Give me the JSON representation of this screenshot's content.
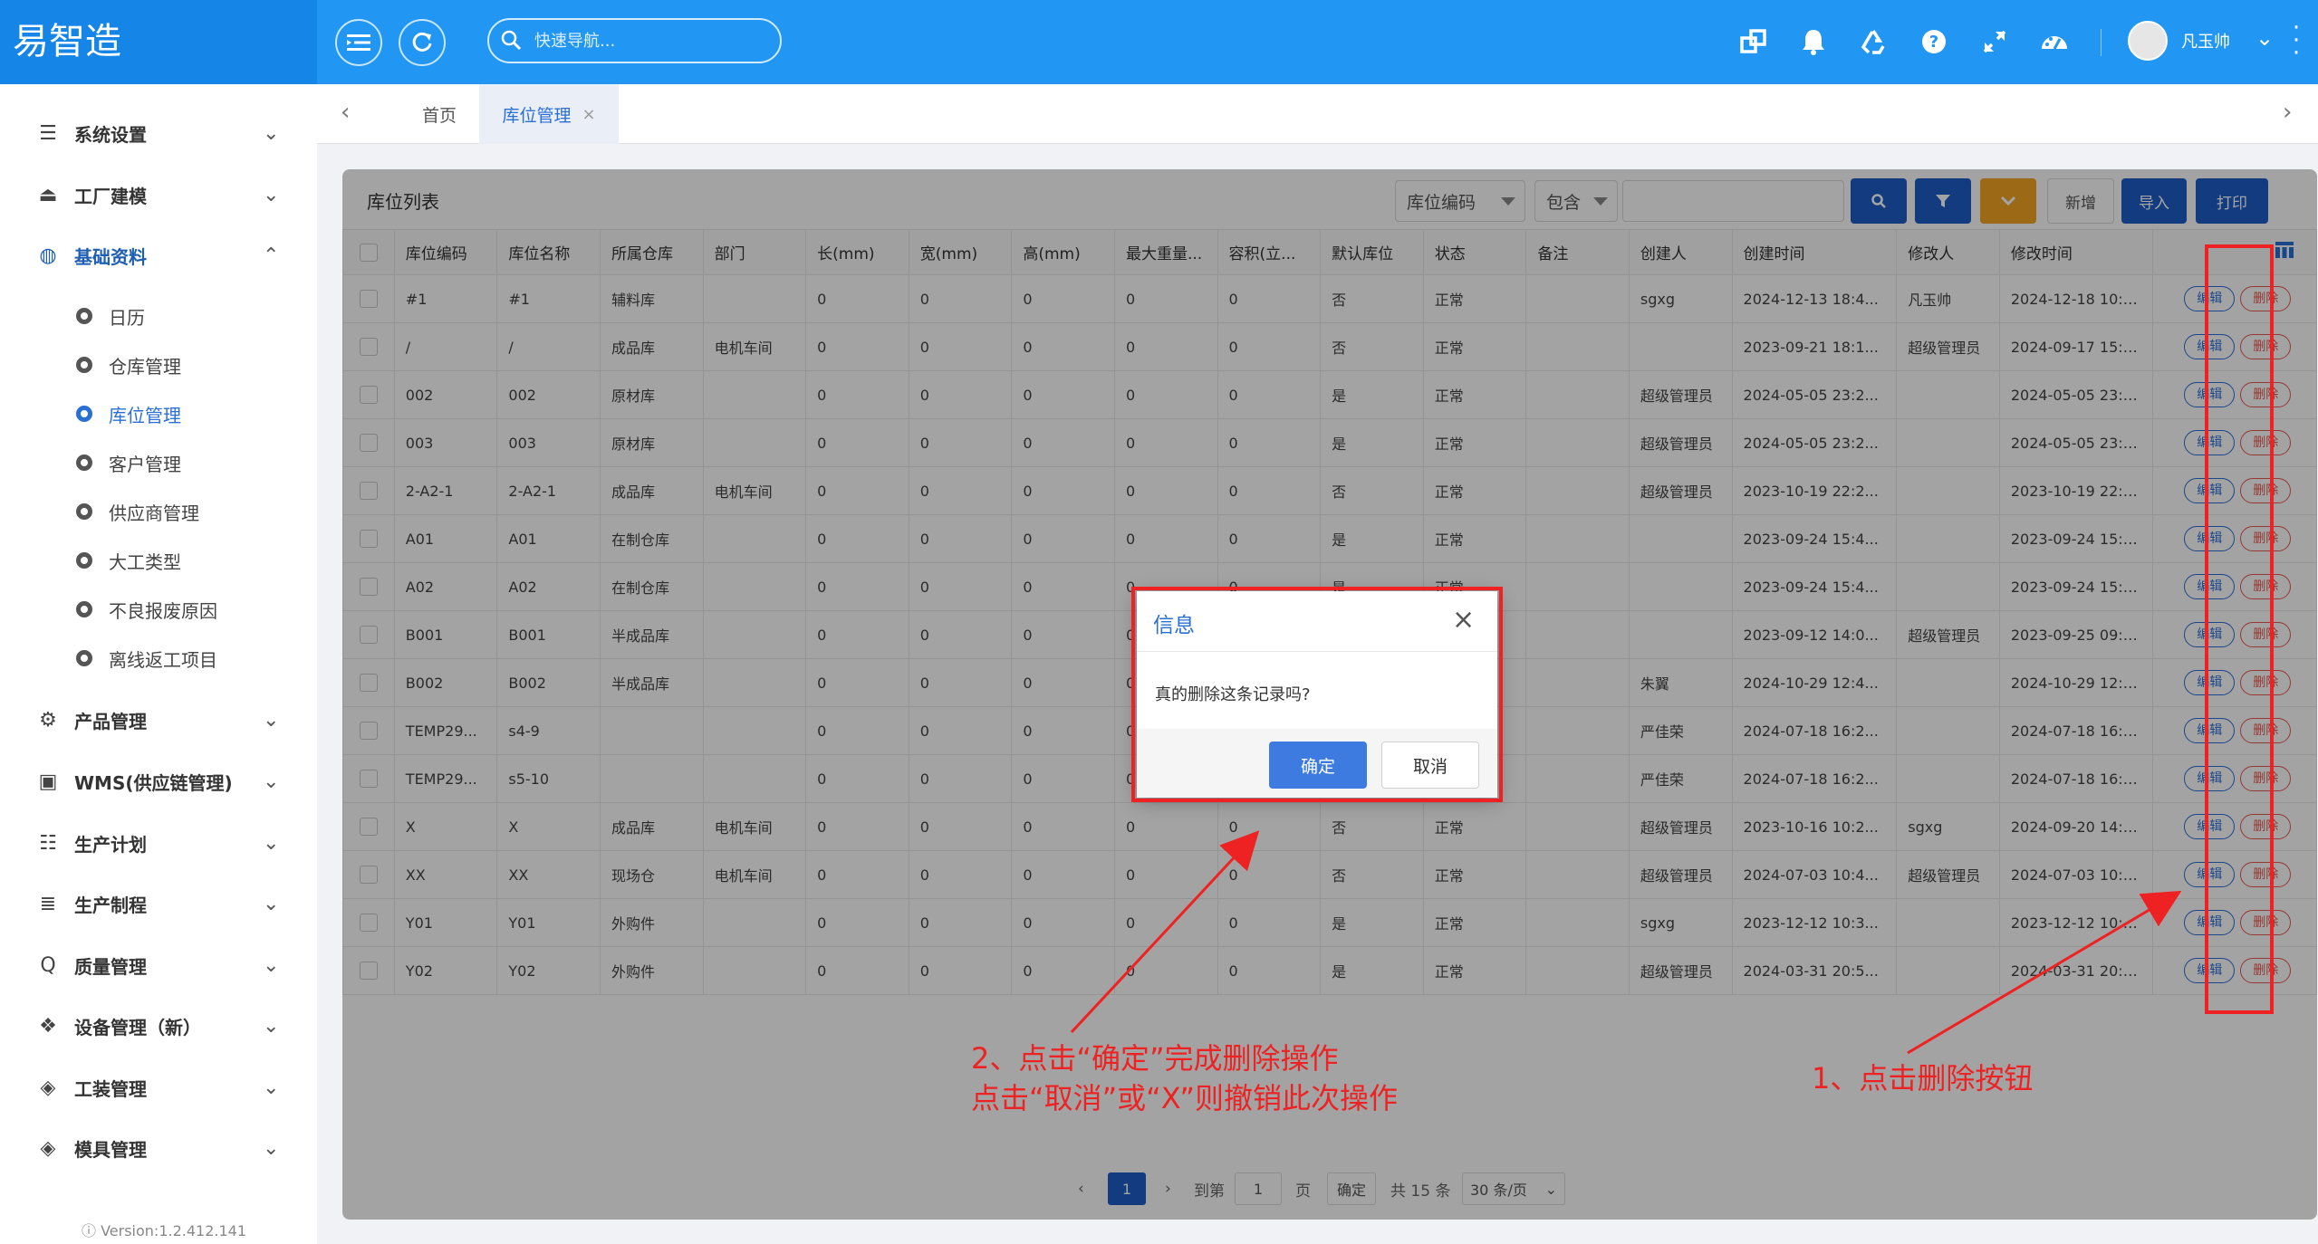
{
  "app": {
    "logo": "易智造"
  },
  "header": {
    "search_placeholder": "快速导航...",
    "username": "凡玉帅",
    "icons": [
      "hamburger-icon",
      "refresh-icon",
      "search-icon",
      "window-icon",
      "bell-icon",
      "recycle-icon",
      "help-icon",
      "expand-icon",
      "dashboard-icon"
    ]
  },
  "sidebar": {
    "menus": [
      {
        "label": "系统设置",
        "icon": "list-icon"
      },
      {
        "label": "工厂建模",
        "icon": "eject-icon"
      },
      {
        "label": "基础资料",
        "icon": "compass-icon"
      },
      {
        "label": "产品管理",
        "icon": "gears-icon"
      },
      {
        "label": "WMS(供应链管理)",
        "icon": "monitor-icon"
      },
      {
        "label": "生产计划",
        "icon": "sliders-icon"
      },
      {
        "label": "生产制程",
        "icon": "stack-icon"
      },
      {
        "label": "质量管理",
        "icon": "quality-icon"
      },
      {
        "label": "设备管理（新）",
        "icon": "cubes-icon"
      },
      {
        "label": "工装管理",
        "icon": "cube-icon"
      },
      {
        "label": "模具管理",
        "icon": "cube-icon"
      }
    ],
    "sub_items": [
      "日历",
      "仓库管理",
      "库位管理",
      "客户管理",
      "供应商管理",
      "大工类型",
      "不良报废原因",
      "离线返工项目"
    ],
    "version": "ⓘ Version:1.2.412.141"
  },
  "tabs": [
    {
      "label": "首页"
    },
    {
      "label": "库位管理",
      "close": "×"
    }
  ],
  "panel": {
    "title": "库位列表",
    "filter_field": "库位编码",
    "filter_op": "包含",
    "buttons": {
      "add": "新增",
      "import": "导入",
      "print": "打印"
    }
  },
  "table": {
    "columns": [
      "库位编码",
      "库位名称",
      "所属仓库",
      "部门",
      "长(mm)",
      "宽(mm)",
      "高(mm)",
      "最大重量...",
      "容积(立...",
      "默认库位",
      "状态",
      "备注",
      "创建人",
      "创建时间",
      "修改人",
      "修改时间"
    ],
    "edit_label": "编辑",
    "delete_label": "删除",
    "rows": [
      [
        "#1",
        "#1",
        "辅料库",
        "",
        "0",
        "0",
        "0",
        "0",
        "0",
        "否",
        "正常",
        "",
        "sgxg",
        "2024-12-13 18:4...",
        "凡玉帅",
        "2024-12-18 10:1..."
      ],
      [
        "/",
        "/",
        "成品库",
        "电机车间",
        "0",
        "0",
        "0",
        "0",
        "0",
        "否",
        "正常",
        "",
        "",
        "2023-09-21 18:1...",
        "超级管理员",
        "2024-09-17 15:0..."
      ],
      [
        "002",
        "002",
        "原材库",
        "",
        "0",
        "0",
        "0",
        "0",
        "0",
        "是",
        "正常",
        "",
        "超级管理员",
        "2024-05-05 23:2...",
        "",
        "2024-05-05 23:2..."
      ],
      [
        "003",
        "003",
        "原材库",
        "",
        "0",
        "0",
        "0",
        "0",
        "0",
        "是",
        "正常",
        "",
        "超级管理员",
        "2024-05-05 23:2...",
        "",
        "2024-05-05 23:2..."
      ],
      [
        "2-A2-1",
        "2-A2-1",
        "成品库",
        "电机车间",
        "0",
        "0",
        "0",
        "0",
        "0",
        "否",
        "正常",
        "",
        "超级管理员",
        "2023-10-19 22:2...",
        "",
        "2023-10-19 22:2..."
      ],
      [
        "A01",
        "A01",
        "在制仓库",
        "",
        "0",
        "0",
        "0",
        "0",
        "0",
        "是",
        "正常",
        "",
        "",
        "2023-09-24 15:4...",
        "",
        "2023-09-24 15:4..."
      ],
      [
        "A02",
        "A02",
        "在制仓库",
        "",
        "0",
        "0",
        "0",
        "0",
        "0",
        "是",
        "正常",
        "",
        "",
        "2023-09-24 15:4...",
        "",
        "2023-09-24 15:4..."
      ],
      [
        "B001",
        "B001",
        "半成品库",
        "",
        "0",
        "0",
        "0",
        "0",
        "0",
        "",
        "",
        "",
        "",
        "2023-09-12 14:0...",
        "超级管理员",
        "2023-09-25 09:4..."
      ],
      [
        "B002",
        "B002",
        "半成品库",
        "",
        "0",
        "0",
        "0",
        "0",
        "0",
        "",
        "",
        "",
        "朱翼",
        "2024-10-29 12:4...",
        "",
        "2024-10-29 12:4..."
      ],
      [
        "TEMP29...",
        "s4-9",
        "",
        "",
        "0",
        "0",
        "0",
        "0",
        "0",
        "",
        "",
        "",
        "严佳荣",
        "2024-07-18 16:2...",
        "",
        "2024-07-18 16:2..."
      ],
      [
        "TEMP29...",
        "s5-10",
        "",
        "",
        "0",
        "0",
        "0",
        "0",
        "0",
        "",
        "",
        "",
        "严佳荣",
        "2024-07-18 16:2...",
        "",
        "2024-07-18 16:2..."
      ],
      [
        "X",
        "X",
        "成品库",
        "电机车间",
        "0",
        "0",
        "0",
        "0",
        "0",
        "否",
        "正常",
        "",
        "超级管理员",
        "2023-10-16 10:2...",
        "sgxg",
        "2024-09-20 14:2..."
      ],
      [
        "XX",
        "XX",
        "现场仓",
        "电机车间",
        "0",
        "0",
        "0",
        "0",
        "0",
        "否",
        "正常",
        "",
        "超级管理员",
        "2024-07-03 10:4...",
        "超级管理员",
        "2024-07-03 10:4..."
      ],
      [
        "Y01",
        "Y01",
        "外购件",
        "",
        "0",
        "0",
        "0",
        "0",
        "0",
        "是",
        "正常",
        "",
        "sgxg",
        "2023-12-12 10:3...",
        "",
        "2023-12-12 10:3..."
      ],
      [
        "Y02",
        "Y02",
        "外购件",
        "",
        "0",
        "0",
        "0",
        "0",
        "0",
        "是",
        "正常",
        "",
        "超级管理员",
        "2024-03-31 20:5...",
        "",
        "2024-03-31 20:5..."
      ]
    ]
  },
  "pagination": {
    "current_page": "1",
    "goto_label": "到第",
    "goto_value": "1",
    "page_suffix": "页",
    "confirm": "确定",
    "total": "共 15 条",
    "page_size": "30 条/页"
  },
  "dialog": {
    "title": "信息",
    "message": "真的删除这条记录吗?",
    "ok": "确定",
    "cancel": "取消",
    "close": "×"
  },
  "annotations": {
    "step1": "1、点击删除按钮",
    "step2_line1": "2、点击“确定”完成删除操作",
    "step2_line2": "点击“取消”或“X”则撤销此次操作",
    "color": "#ee2222"
  },
  "colors": {
    "brand": "#2196f3",
    "logo_bg": "#1585e8",
    "primary_btn": "#1f5fc9",
    "warning_btn": "#f5a623",
    "danger": "#e85a4f"
  }
}
